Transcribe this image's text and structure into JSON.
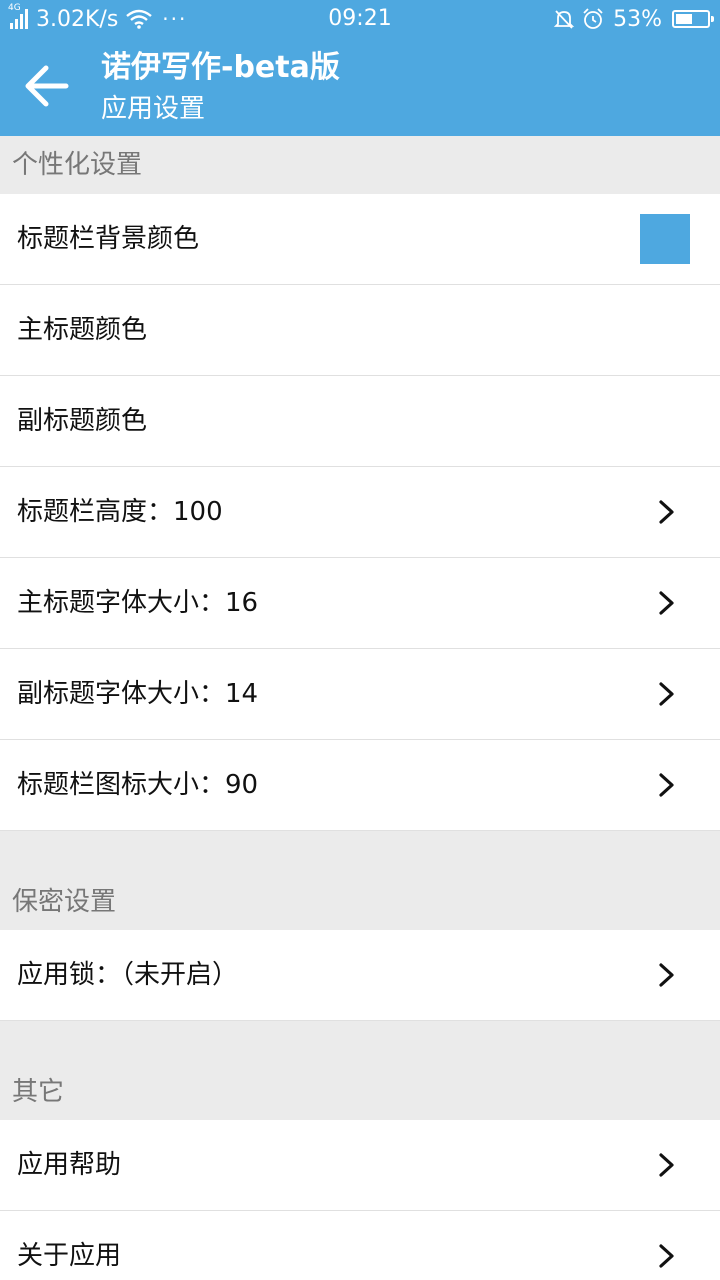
{
  "status": {
    "network_tag": "4G",
    "speed": "3.02K/s",
    "more": "···",
    "time": "09:21",
    "battery": "53%",
    "battery_level": 0.53,
    "icons": [
      "signal-icon",
      "wifi-icon",
      "mute-bell-icon",
      "alarm-icon",
      "battery-icon"
    ]
  },
  "appbar": {
    "title": "诺伊写作-beta版",
    "subtitle": "应用设置",
    "background": "#4ea8e0"
  },
  "sections": {
    "personal": {
      "header": "个性化设置",
      "items": [
        {
          "label": "标题栏背景颜色",
          "swatch_color": "#4ea8e0"
        },
        {
          "label": "主标题颜色"
        },
        {
          "label": "副标题颜色"
        },
        {
          "label": "标题栏高度：100"
        },
        {
          "label": "主标题字体大小：16"
        },
        {
          "label": "副标题字体大小：14"
        },
        {
          "label": "标题栏图标大小：90"
        }
      ]
    },
    "privacy": {
      "header": "保密设置",
      "items": [
        {
          "label": "应用锁：（未开启）"
        }
      ]
    },
    "other": {
      "header": "其它",
      "items": [
        {
          "label": "应用帮助"
        },
        {
          "label": "关于应用"
        }
      ]
    }
  }
}
